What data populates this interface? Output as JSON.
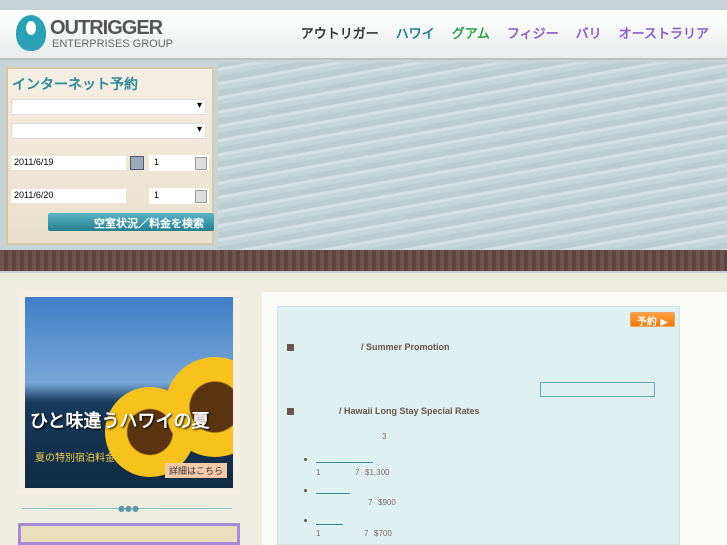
{
  "header": {
    "logo_name": "OUTRIGGER",
    "logo_sub": "ENTERPRISES GROUP",
    "nav": [
      {
        "label": "アウトリガー",
        "color": "#333333"
      },
      {
        "label": "ハワイ",
        "color": "#1f7f8c"
      },
      {
        "label": "グアム",
        "color": "#2da24a"
      },
      {
        "label": "フィジー",
        "color": "#8a5cc8"
      },
      {
        "label": "バリ",
        "color": "#8a5cc8"
      },
      {
        "label": "オーストラリア",
        "color": "#8a5cc8"
      }
    ]
  },
  "booking": {
    "title": "インターネット予約",
    "checkin": "2011/6/19",
    "checkout": "2011/6/20",
    "rooms": "1",
    "guests": "1",
    "search_label": "空室状況／料金を検索"
  },
  "promo": {
    "title": "ひと味違うハワイの夏",
    "subtitle": "夏の特別宿泊料金",
    "more": "詳細はこちら"
  },
  "content": {
    "reserve_label": "予約 ▶",
    "section1": "/ Summer Promotion",
    "section2": "/ Hawaii Long Stay Special Rates",
    "note": "3",
    "items": [
      {
        "a": "1",
        "b": "7",
        "price": "$1,300"
      },
      {
        "a": "",
        "b": "7",
        "price": "$900"
      },
      {
        "a": "1",
        "b": "7",
        "price": "$700"
      }
    ]
  }
}
